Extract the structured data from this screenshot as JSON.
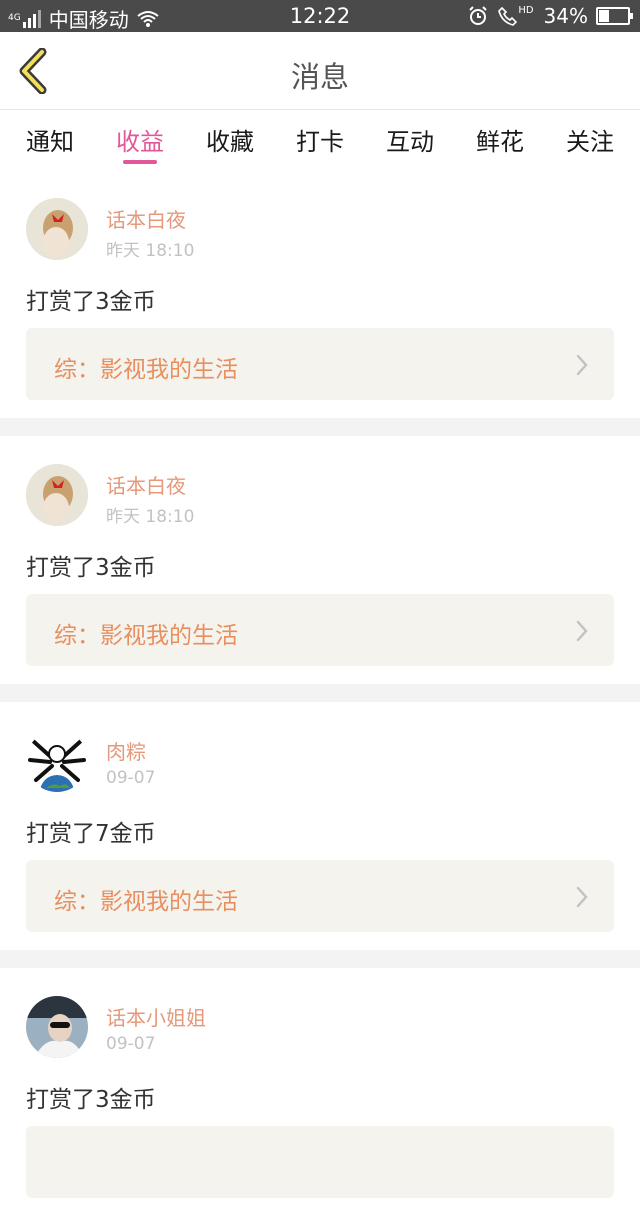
{
  "status_bar": {
    "network": "4G",
    "carrier": "中国移动",
    "time": "12:22",
    "hd": "HD",
    "battery": "34%",
    "battery_level": 0.34,
    "icons": [
      "signal-icon",
      "wifi-icon",
      "alarm-icon",
      "call-hd-icon",
      "battery-icon"
    ]
  },
  "header": {
    "title": "消息",
    "back_icon": "chevron-left-icon"
  },
  "tabs": [
    {
      "label": "通知"
    },
    {
      "label": "收益",
      "active": true
    },
    {
      "label": "收藏"
    },
    {
      "label": "打卡"
    },
    {
      "label": "互动"
    },
    {
      "label": "鲜花"
    },
    {
      "label": "关注"
    }
  ],
  "messages": [
    {
      "user": "话本白夜",
      "time": "昨天 18:10",
      "text": "打赏了3金币",
      "link": "综：影视我的生活",
      "avatar": "avatar-girl-red-bow"
    },
    {
      "user": "话本白夜",
      "time": "昨天 18:10",
      "text": "打赏了3金币",
      "link": "综：影视我的生活",
      "avatar": "avatar-girl-red-bow"
    },
    {
      "user": "肉粽",
      "time": "09-07",
      "text": "打赏了7金币",
      "link": "综：影视我的生活",
      "avatar": "avatar-globe"
    },
    {
      "user": "话本小姐姐",
      "time": "09-07",
      "text": "打赏了3金币",
      "link": "",
      "avatar": "avatar-car-driver"
    }
  ],
  "colors": {
    "accent": "#e2569a",
    "username": "#e5987a",
    "link": "#e98f5e",
    "status_bar": "#4a4a4a"
  }
}
